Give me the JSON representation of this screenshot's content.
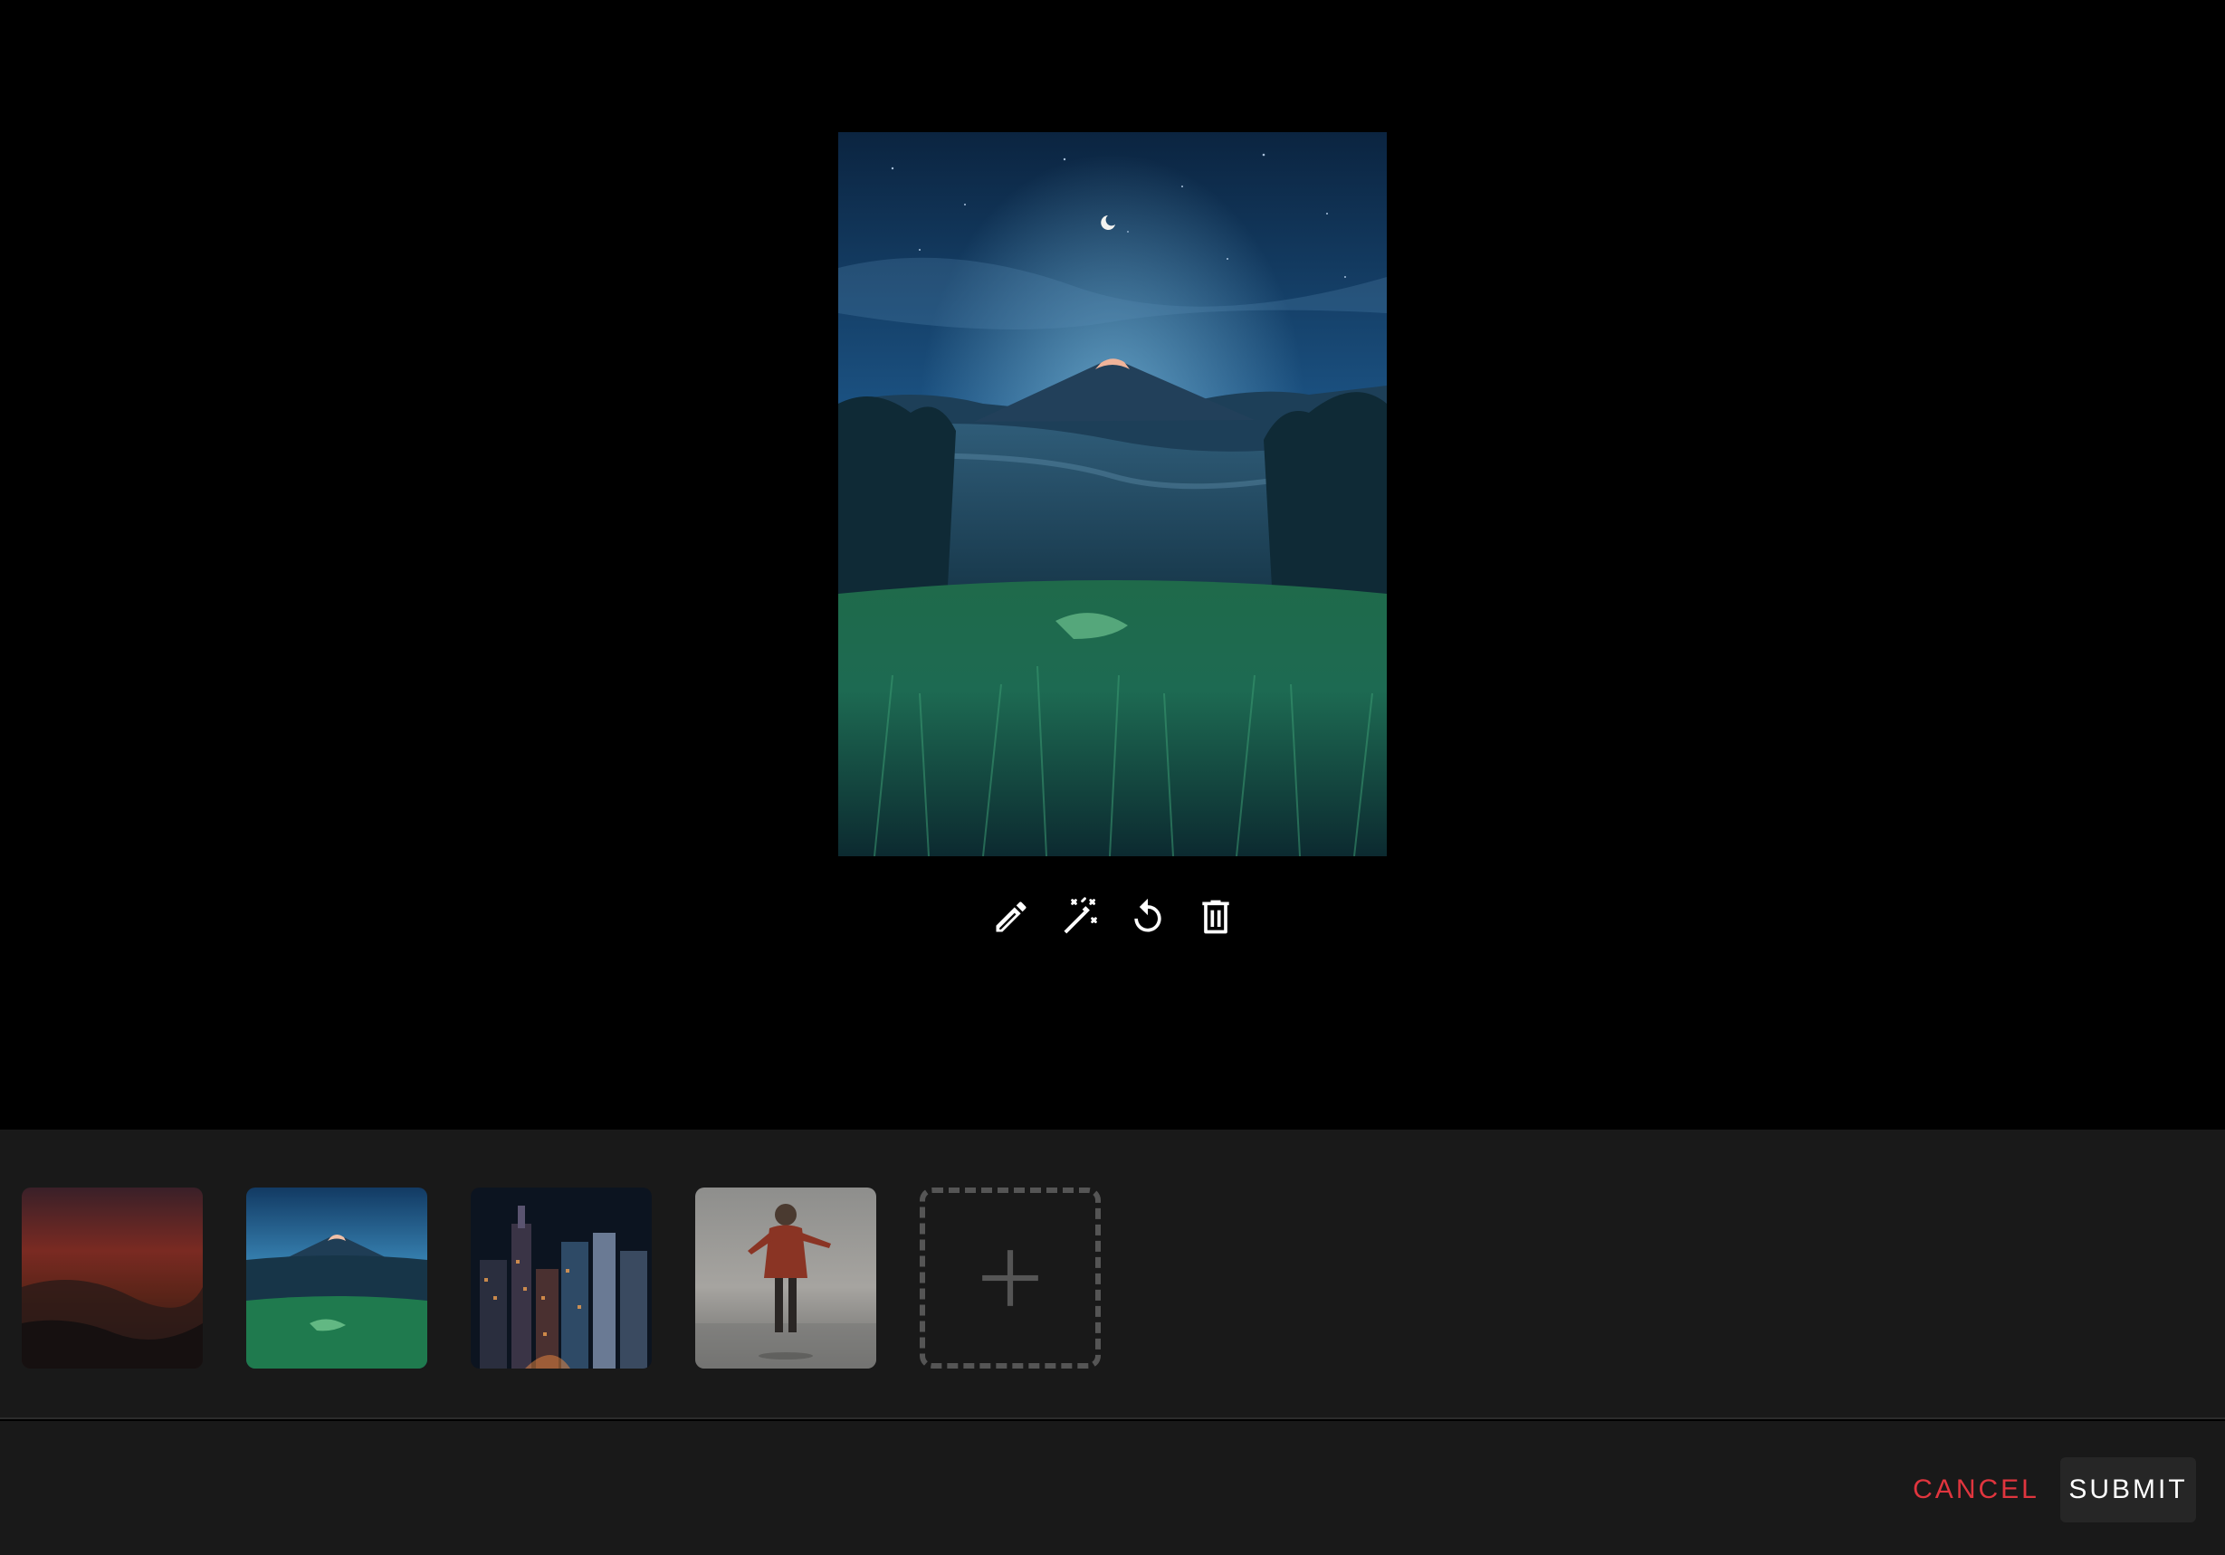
{
  "preview": {
    "icon": "night-mountain-landscape-photo"
  },
  "toolbar": {
    "edit_icon": "pencil-icon",
    "enhance_icon": "magic-wand-icon",
    "rotate_icon": "rotate-icon",
    "delete_icon": "trash-icon"
  },
  "thumbnails": [
    {
      "icon": "red-sunset-sky-photo",
      "selected": false
    },
    {
      "icon": "night-mountain-landscape-photo",
      "selected": true
    },
    {
      "icon": "city-skyline-night-photo",
      "selected": false
    },
    {
      "icon": "person-on-beach-photo",
      "selected": false
    }
  ],
  "add_tile": {
    "icon": "plus-icon"
  },
  "footer": {
    "cancel_label": "CANCEL",
    "submit_label": "SUBMIT"
  },
  "colors": {
    "background": "#000000",
    "panel": "#191919",
    "cancel_accent": "#e0353e",
    "submit_bg": "#262626"
  }
}
